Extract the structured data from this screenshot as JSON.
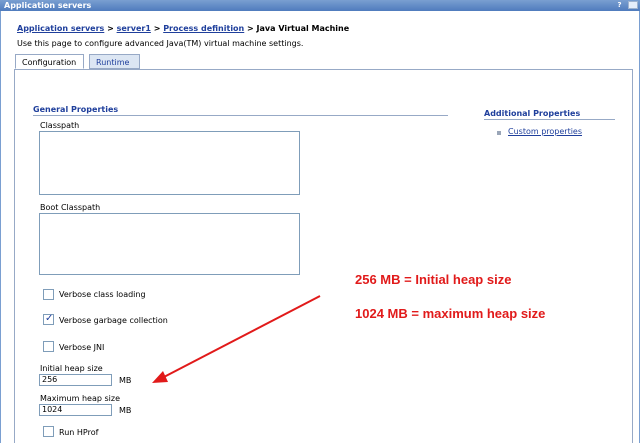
{
  "window": {
    "title": "Application servers",
    "help_glyph": "?"
  },
  "breadcrumb": {
    "items": [
      "Application servers",
      "server1",
      "Process definition"
    ],
    "separator": ">",
    "current": "Java Virtual Machine"
  },
  "description": "Use this page to configure advanced Java(TM) virtual machine settings.",
  "tabs": [
    {
      "label": "Configuration",
      "active": true
    },
    {
      "label": "Runtime",
      "active": false
    }
  ],
  "general_properties": {
    "title": "General Properties",
    "classpath_label": "Classpath",
    "boot_classpath_label": "Boot Classpath",
    "verbose_class_loading": {
      "label": "Verbose class loading",
      "checked": false
    },
    "verbose_gc": {
      "label": "Verbose garbage collection",
      "checked": true
    },
    "verbose_jni": {
      "label": "Verbose JNI",
      "checked": false
    },
    "initial_heap": {
      "label": "Initial heap size",
      "value": "256",
      "unit": "MB"
    },
    "maximum_heap": {
      "label": "Maximum heap size",
      "value": "1024",
      "unit": "MB"
    },
    "run_hprof": {
      "label": "Run HProf",
      "checked": false
    }
  },
  "additional_properties": {
    "title": "Additional Properties",
    "links": [
      "Custom properties"
    ]
  },
  "annotations": {
    "line1": "256 MB = Initial heap size",
    "line2": "1024 MB = maximum heap size",
    "color": "#e11a1a"
  },
  "colors": {
    "link": "#1f3f9c",
    "titlebar": "#4f7bbd",
    "border": "#97a9c6"
  }
}
